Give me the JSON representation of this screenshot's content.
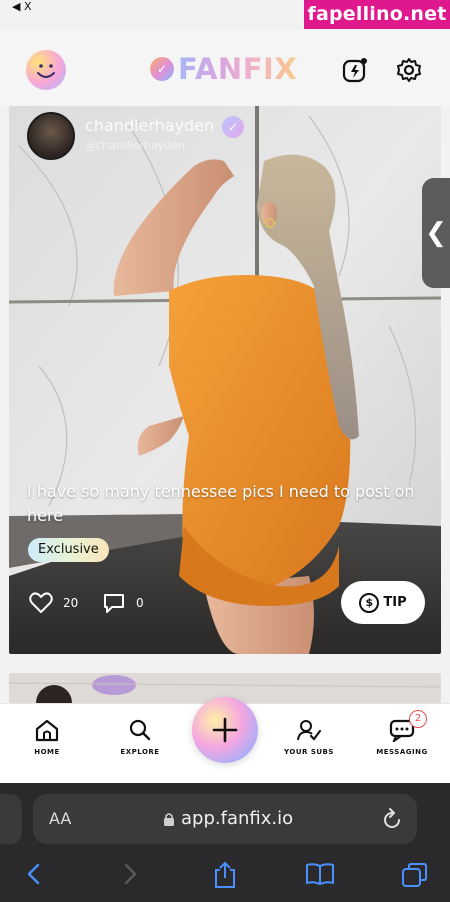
{
  "status_bar": {
    "back_label": "◀ X"
  },
  "watermark": {
    "text": "fapellino.net",
    "color": "#e0188e"
  },
  "header": {
    "logo_text": "FANFIX",
    "profile_icon": "smiley-face-icon",
    "notifications_icon": "lightning-notification-icon",
    "settings_icon": "gear-icon"
  },
  "post": {
    "author_name": "chandlerhayden",
    "author_handle": "@chandlerhayden",
    "caption": "I have so many tennessee pics I need to post on here",
    "exclusive_label": "Exclusive",
    "likes": "20",
    "comments": "0",
    "tip_label": "TIP"
  },
  "side_tab": {
    "glyph": "❮"
  },
  "nav": {
    "items": [
      {
        "label": "HOME",
        "icon": "home-icon"
      },
      {
        "label": "EXPLORE",
        "icon": "search-icon"
      },
      {
        "label": "",
        "icon": "plus-icon"
      },
      {
        "label": "YOUR SUBS",
        "icon": "subscriptions-icon"
      },
      {
        "label": "MESSAGING",
        "icon": "messaging-icon"
      }
    ],
    "messaging_badge": "2"
  },
  "browser": {
    "aa_label": "AA",
    "url": "app.fanfix.io"
  },
  "colors": {
    "accent_gradient_start": "#a6b6f5",
    "accent_gradient_end": "#f6c98b",
    "ios_link_blue": "#4a90ff"
  }
}
